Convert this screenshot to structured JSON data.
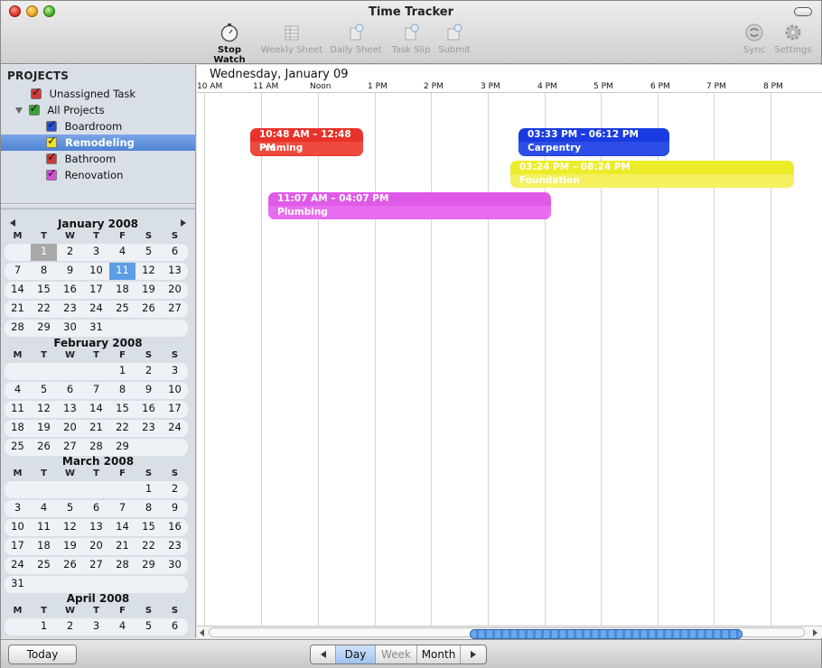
{
  "window": {
    "title": "Time Tracker"
  },
  "toolbar": {
    "stop_watch": "Stop Watch",
    "weekly_sheet": "Weekly Sheet",
    "daily_sheet": "Daily Sheet",
    "task_slip": "Task Slip",
    "submit": "Submit",
    "sync": "Sync",
    "settings": "Settings"
  },
  "sidebar": {
    "heading": "PROJECTS",
    "items": [
      {
        "label": "Unassigned Task",
        "check_color": "#d23a3a"
      },
      {
        "label": "All Projects",
        "check_color": "#3aa33a"
      },
      {
        "label": "Boardroom",
        "check_color": "#2a4fd8"
      },
      {
        "label": "Remodeling",
        "check_color": "#f3e02a"
      },
      {
        "label": "Bathroom",
        "check_color": "#d23a3a"
      },
      {
        "label": "Renovation",
        "check_color": "#d64fd8"
      }
    ],
    "selected": "Remodeling"
  },
  "calendars": {
    "dow": [
      "M",
      "T",
      "W",
      "T",
      "F",
      "S",
      "S"
    ],
    "january": {
      "title": "January 2008",
      "weeks": [
        [
          "",
          "1",
          "2",
          "3",
          "4",
          "5",
          "6"
        ],
        [
          "7",
          "8",
          "9",
          "10",
          "11",
          "12",
          "13"
        ],
        [
          "14",
          "15",
          "16",
          "17",
          "18",
          "19",
          "20"
        ],
        [
          "21",
          "22",
          "23",
          "24",
          "25",
          "26",
          "27"
        ],
        [
          "28",
          "29",
          "30",
          "31",
          "",
          "",
          ""
        ]
      ],
      "today": "1",
      "selected": "11"
    },
    "february": {
      "title": "February 2008",
      "weeks": [
        [
          "",
          "",
          "",
          "",
          "1",
          "2",
          "3"
        ],
        [
          "4",
          "5",
          "6",
          "7",
          "8",
          "9",
          "10"
        ],
        [
          "11",
          "12",
          "13",
          "14",
          "15",
          "16",
          "17"
        ],
        [
          "18",
          "19",
          "20",
          "21",
          "22",
          "23",
          "24"
        ],
        [
          "25",
          "26",
          "27",
          "28",
          "29",
          "",
          ""
        ]
      ]
    },
    "march": {
      "title": "March 2008",
      "weeks": [
        [
          "",
          "",
          "",
          "",
          "",
          "1",
          "2"
        ],
        [
          "3",
          "4",
          "5",
          "6",
          "7",
          "8",
          "9"
        ],
        [
          "10",
          "11",
          "12",
          "13",
          "14",
          "15",
          "16"
        ],
        [
          "17",
          "18",
          "19",
          "20",
          "21",
          "22",
          "23"
        ],
        [
          "24",
          "25",
          "26",
          "27",
          "28",
          "29",
          "30"
        ],
        [
          "31",
          "",
          "",
          "",
          "",
          "",
          ""
        ]
      ]
    },
    "april": {
      "title": "April 2008",
      "weeks": [
        [
          "",
          "1",
          "2",
          "3",
          "4",
          "5",
          "6"
        ]
      ]
    }
  },
  "timeline": {
    "date": "Wednesday, January 09",
    "hours": [
      "10 AM",
      "11 AM",
      "Noon",
      "1 PM",
      "2 PM",
      "3 PM",
      "4 PM",
      "5 PM",
      "6 PM",
      "7 PM",
      "8 PM"
    ],
    "events": [
      {
        "time": "10:48 AM – 12:48 PM",
        "name": "Framing",
        "color": "#e8322a"
      },
      {
        "time": "03:33 PM – 06:12 PM",
        "name": "Carpentry",
        "color": "#1a3be0"
      },
      {
        "time": "03:24 PM – 08:24 PM",
        "name": "Foundation",
        "color": "#ecec2a"
      },
      {
        "time": "11:07 AM – 04:07 PM",
        "name": "Plumbing",
        "color": "#e05ae8"
      }
    ]
  },
  "bottombar": {
    "today": "Today",
    "day": "Day",
    "week": "Week",
    "month": "Month"
  }
}
